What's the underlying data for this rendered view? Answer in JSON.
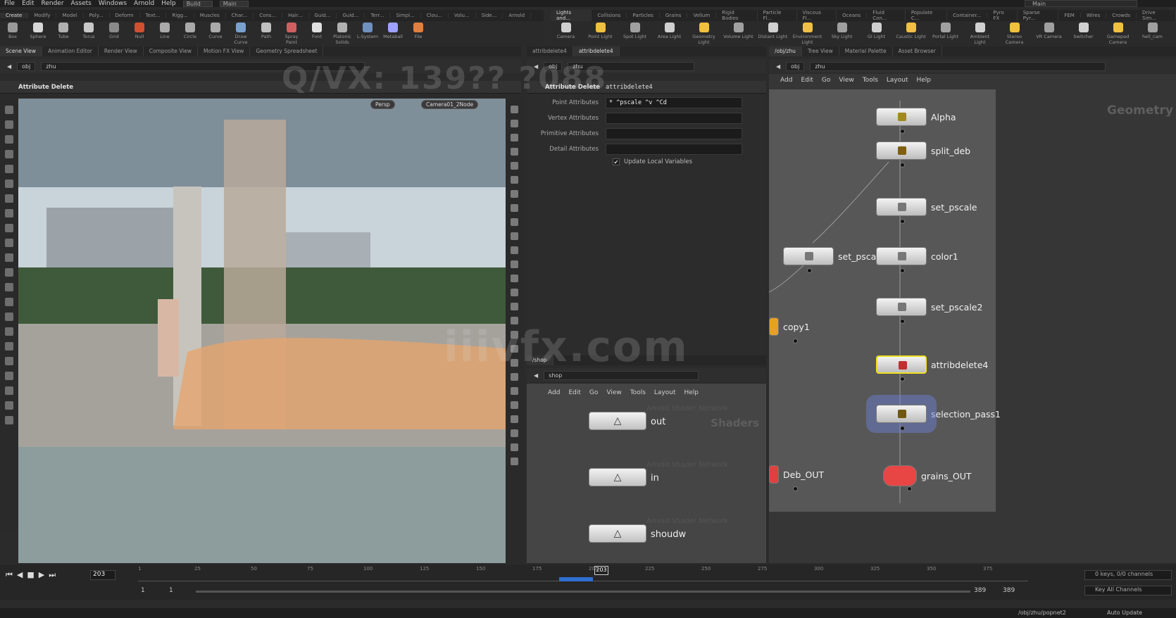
{
  "menu": {
    "items": [
      "File",
      "Edit",
      "Render",
      "Assets",
      "Windows",
      "Arnold",
      "Help"
    ],
    "desktop": "Build",
    "context": "Main",
    "context_right": "Main"
  },
  "shelf_tabs_left": [
    "Create",
    "Modify",
    "Model",
    "Poly...",
    "Deform",
    "Text...",
    "Rigg...",
    "Muscles",
    "Char...",
    "Cons...",
    "Hair...",
    "Guid...",
    "Guid...",
    "Terr...",
    "Simpl...",
    "Clou...",
    "Volu...",
    "Side...",
    "Arnold"
  ],
  "shelf_tabs_right": [
    "Lights and...",
    "Collisions",
    "Particles",
    "Grains",
    "Vellum",
    "Rigid Bodies",
    "Particle Fl...",
    "Viscous Fl...",
    "Oceans",
    "Fluid Con...",
    "Populate C...",
    "Container...",
    "Pyro FX",
    "Sparse Pyr...",
    "FEM",
    "Wires",
    "Crowds",
    "Drive Sim..."
  ],
  "tools_left": [
    "Box",
    "Sphere",
    "Tube",
    "Torus",
    "Grid",
    "Null",
    "Line",
    "Circle",
    "Curve",
    "Draw Curve",
    "Path",
    "Spray Paint",
    "Font",
    "Platonic Solids",
    "L-System",
    "Metaball",
    "File"
  ],
  "tools_right": [
    "Camera",
    "Point Light",
    "Spot Light",
    "Area Light",
    "Geometry Light",
    "Volume Light",
    "Distant Light",
    "Environment Light",
    "Sky Light",
    "GI Light",
    "Caustic Light",
    "Portal Light",
    "Ambient Light",
    "Stereo Camera",
    "VR Camera",
    "Switcher",
    "Gamepad Camera",
    "hell_cam"
  ],
  "pane1": {
    "tabs": [
      "Scene View",
      "Animation Editor",
      "Render View",
      "Composite View",
      "Motion FX View",
      "Geometry Spreadsheet"
    ],
    "path_obj": "obj",
    "path_node": "zhu",
    "title": "Attribute Delete",
    "persp": "Persp",
    "camera": "Camera01_2Node"
  },
  "pane2": {
    "tabs": [
      "attribdelete4",
      "attribdelete4"
    ],
    "path_obj": "obj",
    "path_node": "zhu",
    "title": "Attribute Delete",
    "node_name": "attribdelete4",
    "params": [
      {
        "label": "Point Attributes",
        "value": "* ^pscale ^v ^Cd"
      },
      {
        "label": "Vertex Attributes",
        "value": ""
      },
      {
        "label": "Primitive Attributes",
        "value": ""
      },
      {
        "label": "Detail Attributes",
        "value": ""
      }
    ],
    "checkbox": "Update Local Variables"
  },
  "pane3": {
    "tabs": [
      "/obj/zhu",
      "Tree View",
      "Material Palette",
      "Asset Browser"
    ],
    "path_obj": "obj",
    "path_node": "zhu",
    "menu": [
      "Add",
      "Edit",
      "Go",
      "View",
      "Tools",
      "Layout",
      "Help"
    ],
    "context_label": "Geometry",
    "nodes": [
      {
        "name": "Alpha"
      },
      {
        "name": "split_deb"
      },
      {
        "name": "set_pscale"
      },
      {
        "name": "set_pscale1"
      },
      {
        "name": "color1"
      },
      {
        "name": "set_pscale2"
      },
      {
        "name": "copy1"
      },
      {
        "name": "attribdelete4"
      },
      {
        "name": "selection_pass1"
      },
      {
        "name": "Deb_OUT"
      },
      {
        "name": "grains_OUT"
      }
    ]
  },
  "pane4": {
    "tab": "/shop",
    "path_node": "shop",
    "menu": [
      "Add",
      "Edit",
      "Go",
      "View",
      "Tools",
      "Layout",
      "Help"
    ],
    "context_label": "Shaders",
    "shaders": [
      {
        "type": "Arnold Shader Network",
        "name": "out"
      },
      {
        "type": "Arnold Shader Network",
        "name": "in"
      },
      {
        "type": "Arnold Shader Network",
        "name": "shoudw"
      }
    ]
  },
  "timeline": {
    "frame": "203",
    "marker": "203",
    "ticks": [
      "1",
      "25",
      "50",
      "75",
      "100",
      "125",
      "150",
      "175",
      "200",
      "225",
      "250",
      "275",
      "300",
      "325",
      "350",
      "375"
    ],
    "start": "1",
    "start2": "1",
    "end": "389",
    "end2": "389",
    "keys": "0 keys, 0/0 channels",
    "key_all": "Key All Channels"
  },
  "status": {
    "path": "/obj/zhu/popnet2",
    "auto_update": "Auto Update"
  },
  "watermark": {
    "top": "Q/VX: 139?? ?088",
    "center": "iiivfx.com"
  }
}
